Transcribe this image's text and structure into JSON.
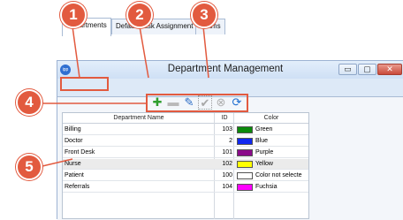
{
  "window": {
    "title": "Department Management",
    "app_icon_text": "ipp",
    "minimize": "▭",
    "maximize": "▢",
    "close": "✕"
  },
  "tabs": [
    {
      "label": "Departments"
    },
    {
      "label": "Default Task Assignment"
    },
    {
      "label": "Teams"
    }
  ],
  "toolbar": {
    "icons": [
      "plus-icon",
      "minus-icon",
      "pencil-icon",
      "check-icon",
      "cancel-icon",
      "refresh-icon"
    ],
    "glyphs": [
      "✚",
      "▬",
      "✎",
      "✔",
      "⊗",
      "⟳"
    ]
  },
  "grid": {
    "headers": {
      "name": "Department Name",
      "id": "ID",
      "color": "Color"
    },
    "rows": [
      {
        "name": "Billing",
        "id": "103",
        "color_label": "Green",
        "swatch": "#0b8a0b"
      },
      {
        "name": "Doctor",
        "id": "2",
        "color_label": "Blue",
        "swatch": "#1028f0"
      },
      {
        "name": "Front Desk",
        "id": "101",
        "color_label": "Purple",
        "swatch": "#8a0a8a"
      },
      {
        "name": "Nurse",
        "id": "102",
        "color_label": "Yellow",
        "swatch": "#ffff00",
        "selected": true
      },
      {
        "name": "Patient",
        "id": "100",
        "color_label": "Color not selecte",
        "swatch": "#ffffff"
      },
      {
        "name": "Referrals",
        "id": "104",
        "color_label": "Fuchsia",
        "swatch": "#ff00ff"
      }
    ]
  },
  "callouts": [
    "1",
    "2",
    "3",
    "4",
    "5"
  ],
  "colors": {
    "callout": "#e25a3f"
  }
}
